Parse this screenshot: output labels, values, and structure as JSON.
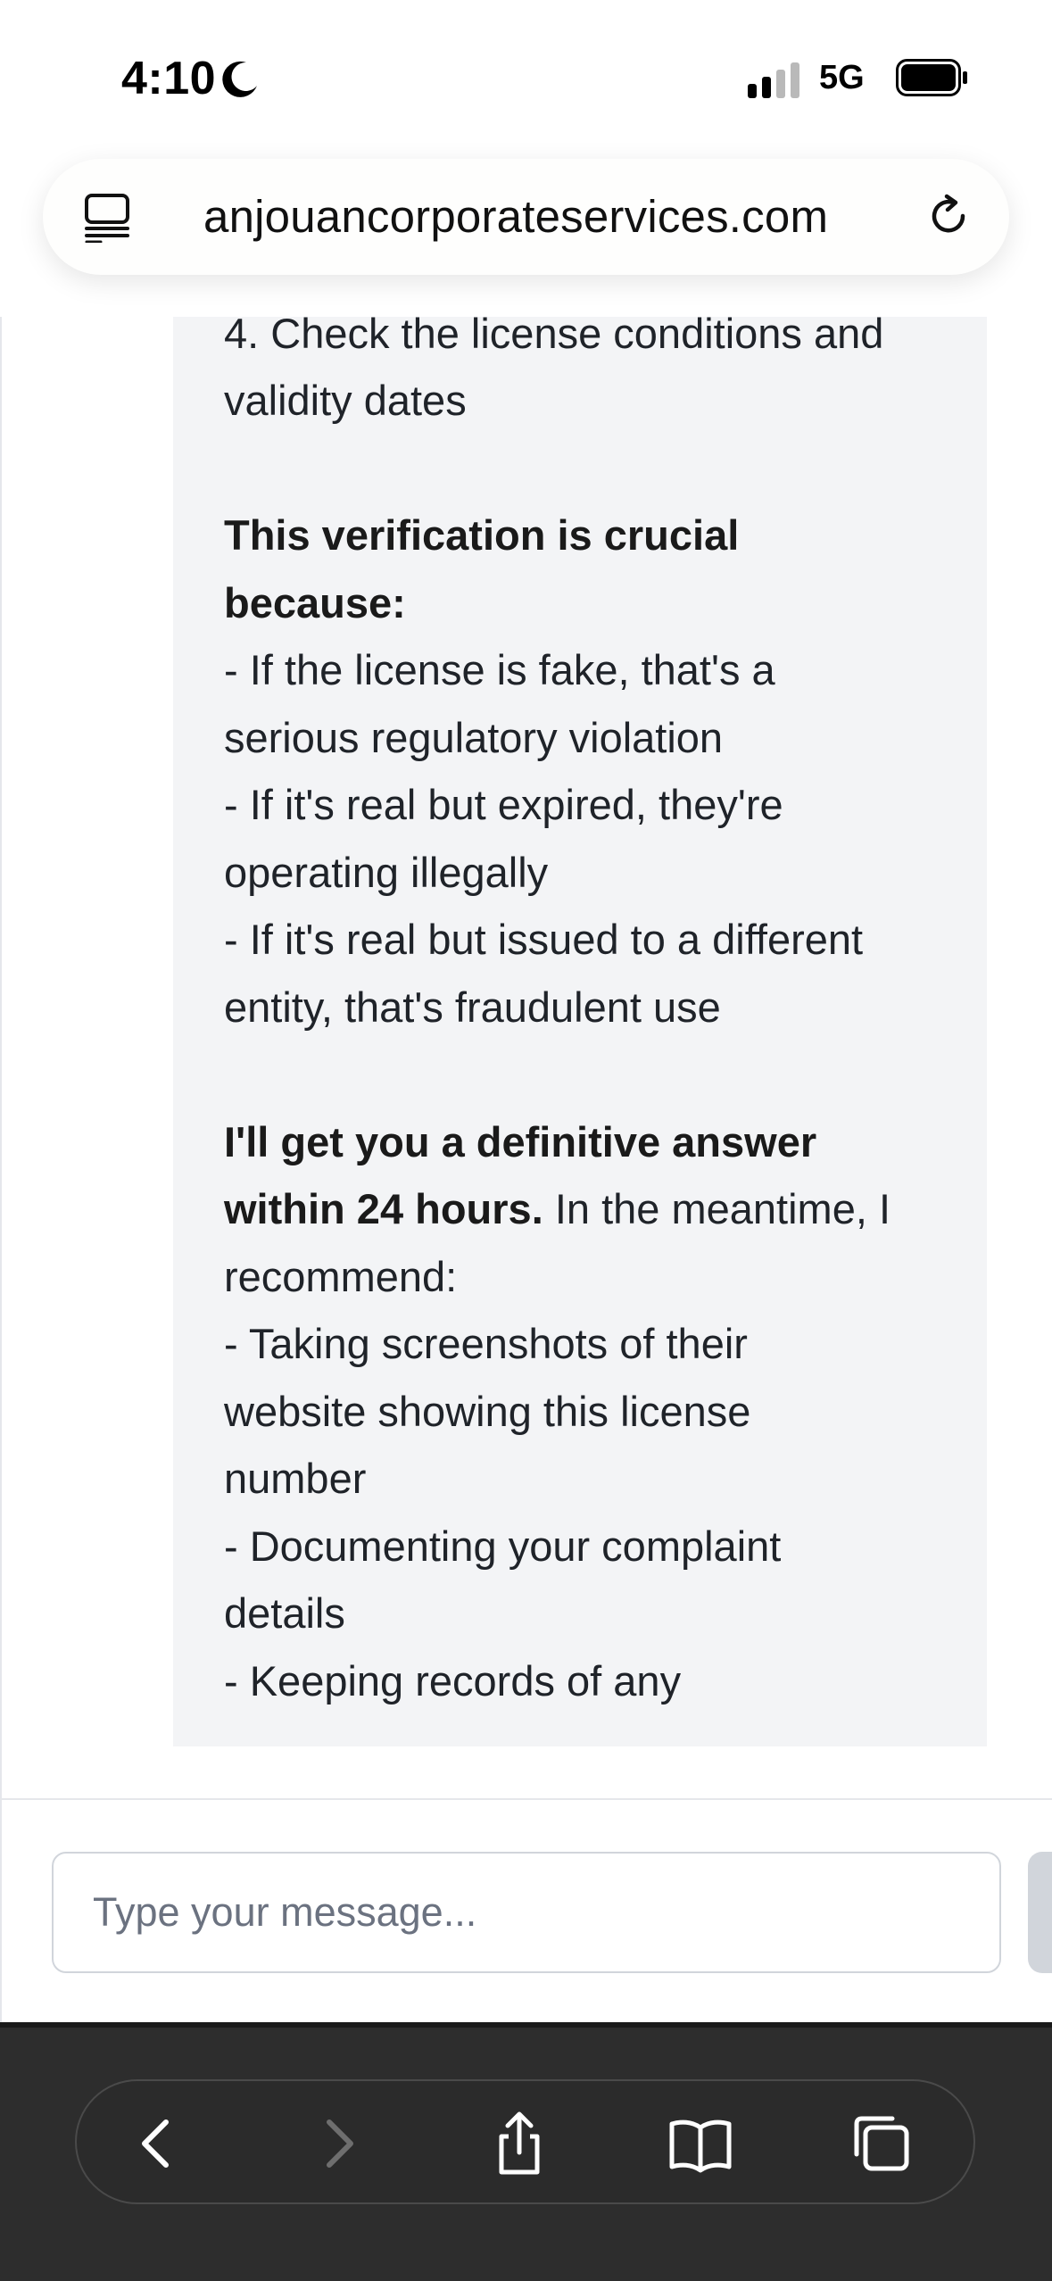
{
  "status_bar": {
    "time": "4:10",
    "network": "5G",
    "icons": [
      "moon-icon",
      "signal-icon",
      "battery-icon"
    ]
  },
  "address_bar": {
    "url": "anjouancorporateservices.com",
    "icons": [
      "page-menu-icon",
      "reload-icon"
    ]
  },
  "chat": {
    "message": {
      "step4_line1": "4. Check the license conditions and",
      "step4_line2": "validity dates",
      "verify_heading_line1": "This verification is crucial",
      "verify_heading_line2": "because:",
      "bullet1_line1": "- If the license is fake, that's a",
      "bullet1_line2": "serious regulatory violation",
      "bullet2_line1": "- If it's real but expired, they're",
      "bullet2_line2": "operating illegally",
      "bullet3_line1": "- If it's real but issued to a different",
      "bullet3_line2": "entity, that's fraudulent use",
      "answer_bold_line1": "I'll get you a definitive answer",
      "answer_bold_line2": "within 24 hours.",
      "answer_rest_line2": " In the meantime, I",
      "answer_line3": "recommend:",
      "rec1_line1": "- Taking screenshots of their",
      "rec1_line2": "website showing this license",
      "rec1_line3": "number",
      "rec2_line1": "- Documenting your complaint",
      "rec2_line2": "details",
      "rec3_line1": "- Keeping records of any"
    }
  },
  "input": {
    "placeholder": "Type your message..."
  },
  "toolbar": {
    "buttons": [
      "back-icon",
      "forward-icon",
      "share-icon",
      "bookmarks-icon",
      "tabs-icon"
    ]
  },
  "colors": {
    "bubble_bg": "#f3f4f6",
    "toolbar_bg": "#2d2d2d",
    "text": "#1f2329",
    "placeholder": "#6b7280"
  }
}
